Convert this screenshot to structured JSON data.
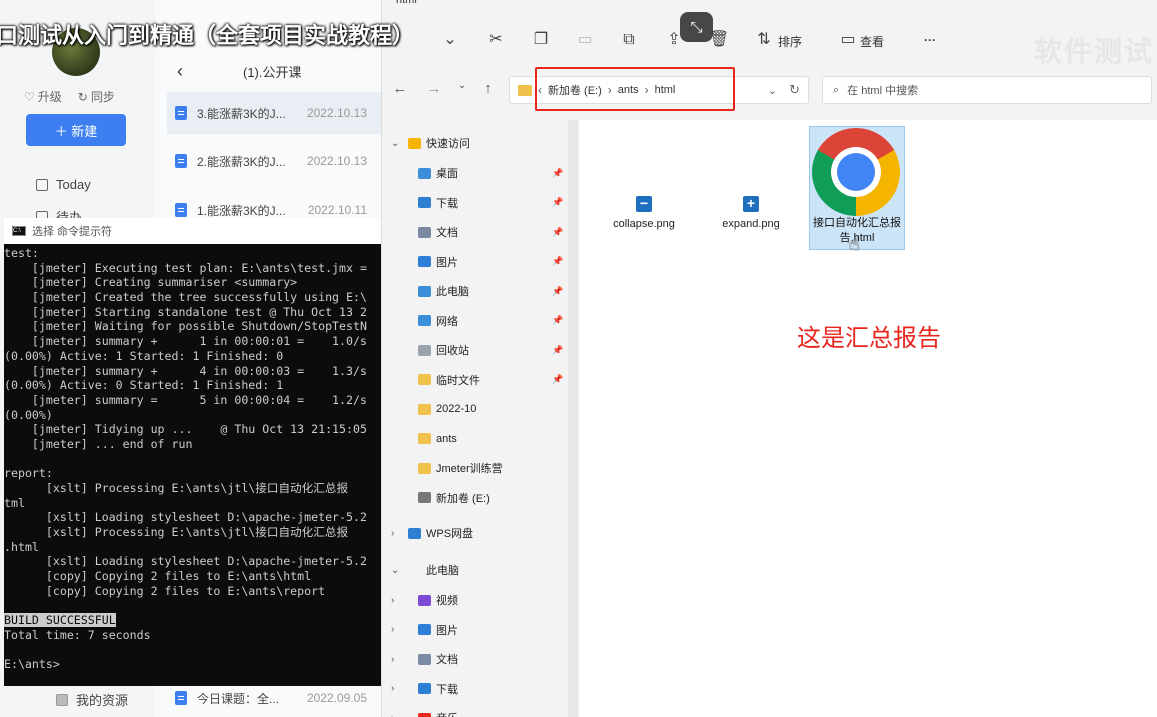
{
  "video_title": "口测试从入门到精通（全套项目实战教程）",
  "notes_app": {
    "upgrade_label": "升级",
    "sync_label": "同步",
    "new_button_label": "＋ 新建",
    "sidebar": [
      {
        "label": "Today",
        "icon": "calendar-icon"
      },
      {
        "label": "待办",
        "icon": "checkbox-icon"
      },
      {
        "label": "我的资源",
        "icon": "folder-icon"
      }
    ],
    "list_title": "(1).公开课",
    "notes": [
      {
        "title": "3.能涨薪3K的J...",
        "date": "2022.10.13"
      },
      {
        "title": "2.能涨薪3K的J...",
        "date": "2022.10.13"
      },
      {
        "title": "1.能涨薪3K的J...",
        "date": "2022.10.11"
      },
      {
        "title": "今日课题：全...",
        "date": "2022.09.05"
      }
    ]
  },
  "cmd": {
    "title": "选择 命令提示符",
    "lines": [
      "test:",
      "    [jmeter] Executing test plan: E:\\ants\\test.jmx =",
      "    [jmeter] Creating summariser <summary>",
      "    [jmeter] Created the tree successfully using E:\\",
      "    [jmeter] Starting standalone test @ Thu Oct 13 2",
      "    [jmeter] Waiting for possible Shutdown/StopTestN",
      "    [jmeter] summary +      1 in 00:00:01 =    1.0/s",
      "(0.00%) Active: 1 Started: 1 Finished: 0",
      "    [jmeter] summary +      4 in 00:00:03 =    1.3/s",
      "(0.00%) Active: 0 Started: 1 Finished: 1",
      "    [jmeter] summary =      5 in 00:00:04 =    1.2/s",
      "(0.00%)",
      "    [jmeter] Tidying up ...    @ Thu Oct 13 21:15:05",
      "    [jmeter] ... end of run",
      "",
      "report:",
      "      [xslt] Processing E:\\ants\\jtl\\接口自动化汇总报",
      "tml",
      "      [xslt] Loading stylesheet D:\\apache-jmeter-5.2",
      "      [xslt] Processing E:\\ants\\jtl\\接口自动化汇总报",
      ".html",
      "      [xslt] Loading stylesheet D:\\apache-jmeter-5.2",
      "      [copy] Copying 2 files to E:\\ants\\html",
      "      [copy] Copying 2 files to E:\\ants\\report",
      "",
      "BUILD SUCCESSFUL",
      "Total time: 7 seconds",
      "",
      "E:\\ants>"
    ]
  },
  "explorer": {
    "window_title": "html",
    "toolbar": {
      "sort_label": "排序",
      "view_label": "查看",
      "more_label": "···"
    },
    "watermark": "软件测试",
    "address": {
      "crumbs": [
        "新加卷 (E:)",
        "ants",
        "html"
      ]
    },
    "search_placeholder": "在 html 中搜索",
    "nav": {
      "quick_access": "快速访问",
      "pinned": [
        "桌面",
        "下载",
        "文档",
        "图片",
        "此电脑",
        "网络",
        "回收站",
        "临时文件"
      ],
      "folders": [
        "2022-10",
        "ants",
        "Jmeter训练营",
        "新加卷 (E:)"
      ],
      "wps": "WPS网盘",
      "this_pc": "此电脑",
      "pc_items": [
        "视频",
        "图片",
        "文档",
        "下载",
        "音乐"
      ]
    },
    "files": [
      {
        "name": "collapse.png",
        "icon": "minus-icon"
      },
      {
        "name": "expand.png",
        "icon": "plus-icon"
      },
      {
        "name": "接口自动化汇总报告.html",
        "icon": "chrome-icon"
      }
    ],
    "annotation": "这是汇总报告"
  }
}
